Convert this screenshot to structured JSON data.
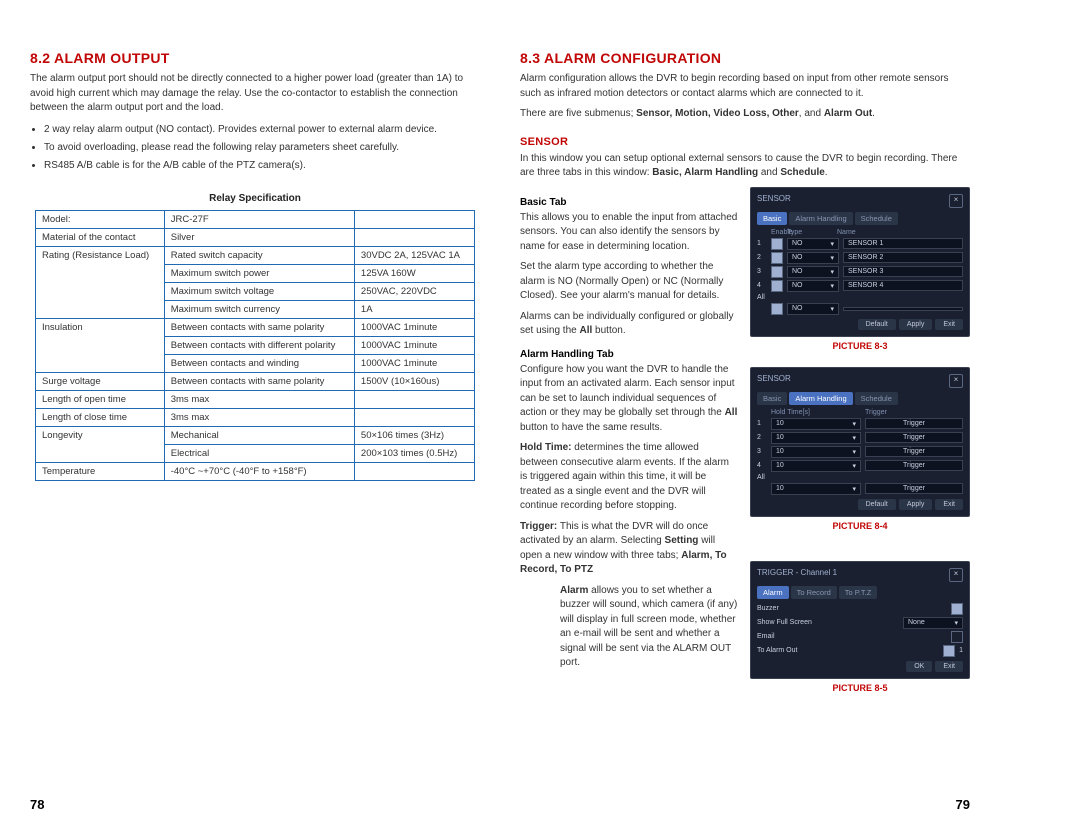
{
  "left": {
    "h1": "8.2 ALARM OUTPUT",
    "intro": "The alarm output port should not be directly connected to a higher power load (greater than 1A) to avoid high current which may damage the relay. Use the co-contactor to establish the connection between the alarm output port and the load.",
    "bul1": "2 way relay alarm output (NO contact). Provides external power to external alarm device.",
    "bul2": "To avoid overloading, please read the following relay parameters sheet carefully.",
    "bul3": "RS485 A/B cable is for the A/B cable of the PTZ camera(s).",
    "tblTitle": "Relay Specification",
    "t": {
      "r1a": "Model:",
      "r1b": "JRC-27F",
      "r1c": "",
      "r2a": "Material of the contact",
      "r2b": "Silver",
      "r2c": "",
      "r3a": "Rating (Resistance Load)",
      "r3b": "Rated switch capacity",
      "r3c": "30VDC 2A, 125VAC 1A",
      "r4b": "Maximum switch power",
      "r4c": "125VA 160W",
      "r5b": "Maximum switch voltage",
      "r5c": "250VAC, 220VDC",
      "r6b": "Maximum switch currency",
      "r6c": "1A",
      "r7a": "Insulation",
      "r7b": "Between contacts with same polarity",
      "r7c": "1000VAC 1minute",
      "r8b": "Between contacts with different polarity",
      "r8c": "1000VAC 1minute",
      "r9b": "Between contacts and winding",
      "r9c": "1000VAC 1minute",
      "r10a": "Surge voltage",
      "r10b": "Between contacts with same polarity",
      "r10c": "1500V (10×160us)",
      "r11a": "Length of open time",
      "r11b": "3ms max",
      "r11c": "",
      "r12a": "Length of close time",
      "r12b": "3ms max",
      "r12c": "",
      "r13a": "Longevity",
      "r13b": "Mechanical",
      "r13c": "50×106 times (3Hz)",
      "r14b": "Electrical",
      "r14c": "200×103 times (0.5Hz)",
      "r15a": "Temperature",
      "r15b": "-40°C ~+70°C (-40°F to +158°F)",
      "r15c": ""
    },
    "page": "78"
  },
  "right": {
    "h1": "8.3 ALARM CONFIGURATION",
    "intro": "Alarm configuration allows the DVR to begin recording based on input from other remote sensors such as infrared motion detectors or contact alarms which are connected to it.",
    "submenus_pre": "There are five submenus; ",
    "submenus_bold": "Sensor, Motion, Video Loss, Other",
    "submenus_pre_and": ", and ",
    "submenus_last": "Alarm Out",
    "submenus_post": ".",
    "h2": "SENSOR",
    "sensor_p1": "In this window you can setup optional external sensors to cause the DVR to begin recording. There are three tabs in this window: ",
    "sensor_bold": "Basic, Alarm Handling",
    "sensor_and": " and ",
    "sensor_sched": "Schedule",
    "sensor_post": ".",
    "h3a": "Basic Tab",
    "basic_p1": "This allows you to enable the input from attached sensors. You can also identify the sensors by name for ease in determining location.",
    "basic_p2": "Set the alarm type according to whether the alarm is NO (Normally Open) or NC (Normally Closed). See your alarm's manual for details.",
    "basic_p3_pre": "Alarms can be individually configured or globally set using the ",
    "basic_p3_bold": "All",
    "basic_p3_post": " button.",
    "h3b": "Alarm Handling Tab",
    "ah_p1_pre": "Configure how you want the DVR to handle the input from an activated alarm. Each sensor input can be set to launch individual sequences of action or they may be globally set through the ",
    "ah_p1_bold": "All",
    "ah_p1_post": " button to have the same results.",
    "hold_label": "Hold Time:",
    "hold_txt": " determines the time allowed between consecutive alarm events. If the alarm is triggered again within this time, it will be treated as a single event and the DVR will continue recording before stopping.",
    "trig_label": "Trigger:",
    "trig_txt_pre": " This is what the DVR will do once activated by an alarm. Selecting ",
    "trig_setting": "Setting",
    "trig_txt_mid": " will open a new window with three tabs; ",
    "trig_tabs": "Alarm, To Record, To PTZ",
    "alarm_label": "Alarm",
    "alarm_txt": " allows you to set whether a buzzer will sound, which camera (if any) will display in full screen mode, whether an e-mail will be sent and whether a signal will be sent via the ALARM OUT port.",
    "pic3": "PICTURE 8-3",
    "pic4": "PICTURE 8-4",
    "pic5": "PICTURE 8-5",
    "page": "79",
    "ss1": {
      "title": "SENSOR",
      "tab1": "Basic",
      "tab2": "Alarm Handling",
      "tab3": "Schedule",
      "h_enable": "Enable",
      "h_type": "Type",
      "h_name": "Name",
      "no": "NO",
      "s1": "SENSOR 1",
      "s2": "SENSOR 2",
      "s3": "SENSOR 3",
      "s4": "SENSOR 4",
      "all": "All",
      "b1": "Default",
      "b2": "Apply",
      "b3": "Exit"
    },
    "ss2": {
      "title": "SENSOR",
      "h_hold": "Hold Time[s]",
      "h_trig": "Trigger",
      "val": "10",
      "trig": "Trigger"
    },
    "ss3": {
      "title": "TRIGGER - Channel 1",
      "tab1": "Alarm",
      "tab2": "To Record",
      "tab3": "To P.T.Z",
      "r1": "Buzzer",
      "r2": "Show Full Screen",
      "r3": "Email",
      "r4": "To Alarm Out",
      "none": "None",
      "one": "1",
      "ok": "OK",
      "exit": "Exit"
    }
  }
}
